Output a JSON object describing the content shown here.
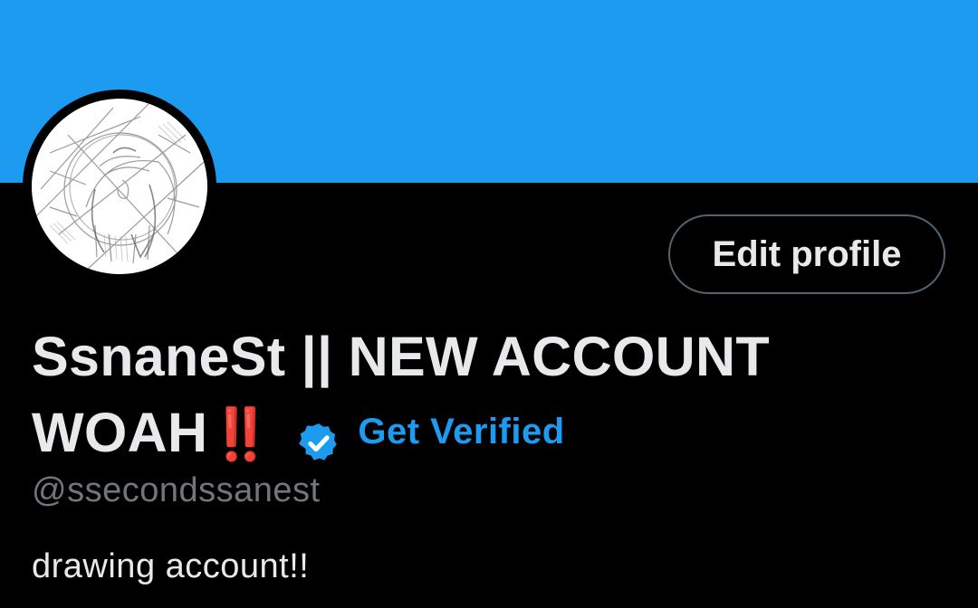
{
  "profile": {
    "display_name_line1": "SsnaneSt || NEW ACCOUNT",
    "display_name_line2": "WOAH",
    "emoji": "‼️",
    "get_verified_label": "Get Verified",
    "handle": "@ssecondssanest",
    "bio": "drawing account!!",
    "edit_profile_label": "Edit profile"
  },
  "icons": {
    "verified": "verified-badge-icon",
    "avatar": "sketch-avatar"
  },
  "colors": {
    "banner": "#1d9bf0",
    "background": "#000000",
    "accent": "#1d9bf0",
    "text": "#e7e9ea",
    "muted": "#71767b",
    "emoji": "#e0202a"
  }
}
